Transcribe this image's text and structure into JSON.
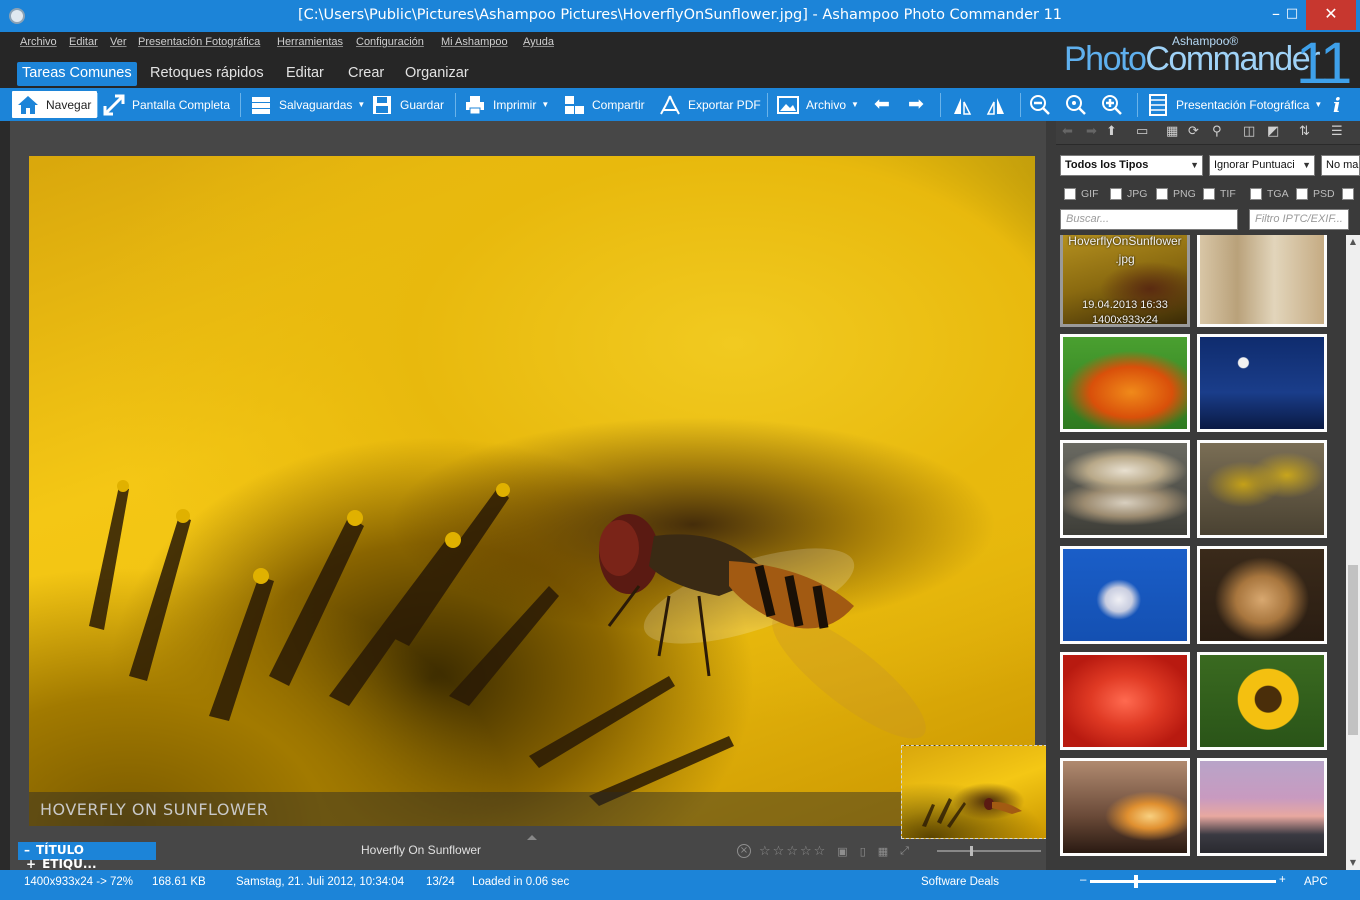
{
  "window": {
    "title": "[C:\\Users\\Public\\Pictures\\Ashampoo Pictures\\HoverflyOnSunflower.jpg] - Ashampoo Photo Commander 11",
    "min_glyph": "–",
    "max_glyph": "□",
    "close_glyph": "✕"
  },
  "menu": [
    "Archivo",
    "Editar",
    "Ver",
    "Presentación Fotográfica",
    "Herramientas",
    "Configuración",
    "Mi Ashampoo",
    "Ayuda"
  ],
  "logo": {
    "photo": "Photo",
    "commander": "Commander",
    "brand": "Ashampoo®",
    "version": "11"
  },
  "tabs": [
    "Tareas Comunes",
    "Retoques rápidos",
    "Editar",
    "Crear",
    "Organizar"
  ],
  "active_tab": "Tareas Comunes",
  "toolbar": {
    "navegar": "Navegar",
    "pantalla": "Pantalla Completa",
    "salvaguardas": "Salvaguardas",
    "guardar": "Guardar",
    "imprimir": "Imprimir",
    "compartir": "Compartir",
    "exportar": "Exportar PDF",
    "archivo": "Archivo",
    "presentacion": "Presentación Fotográfica"
  },
  "viewer": {
    "caption": "HOVERFLY ON SUNFLOWER",
    "title_tag": "TÍTULO",
    "etiq_tag": "ETIQU...",
    "image_name": "Hoverfly On Sunflower",
    "rating_stars": 5,
    "rating": 0
  },
  "filters": {
    "type": "Todos los Tipos",
    "rating": "Ignorar Puntuaci",
    "third": "No ma",
    "formats": [
      "GIF",
      "JPG",
      "PNG",
      "TIF",
      "TGA",
      "PSD"
    ],
    "search_placeholder": "Buscar...",
    "iptc_placeholder": "Filtro IPTC/EXIF..."
  },
  "thumbnails": [
    {
      "name": "HoverflyOnSunflower",
      "ext": ".jpg",
      "date": "19.04.2013 16:33",
      "dims": "1400x933x24",
      "selected": true,
      "subject": "hoverfly-sunflower"
    },
    {
      "name": "",
      "subject": "grass-ladybug"
    },
    {
      "name": "",
      "subject": "orange-lily"
    },
    {
      "name": "",
      "subject": "moon-night"
    },
    {
      "name": "",
      "subject": "mushrooms"
    },
    {
      "name": "",
      "subject": "birds"
    },
    {
      "name": "",
      "subject": "dove-sky"
    },
    {
      "name": "",
      "subject": "dog"
    },
    {
      "name": "",
      "subject": "rose"
    },
    {
      "name": "",
      "subject": "sunflower"
    },
    {
      "name": "",
      "subject": "sunset-grass"
    },
    {
      "name": "",
      "subject": "wind-turbines"
    }
  ],
  "status": {
    "dims": "1400x933x24 -> 72%",
    "size": "168.61 KB",
    "date": "Samstag, 21. Juli 2012, 10:34:04",
    "index": "13/24",
    "loaded": "Loaded in 0.06 sec",
    "deals": "Software Deals",
    "mode": "APC"
  },
  "colors": {
    "accent": "#1c84d8",
    "dark": "#262626",
    "panel": "#3a3a3a"
  }
}
